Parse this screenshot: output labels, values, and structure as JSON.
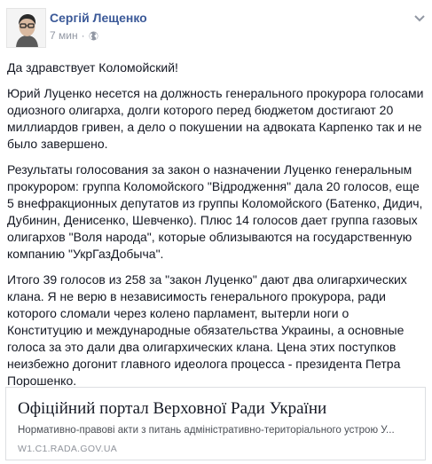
{
  "post": {
    "author": "Сергій Лещенко",
    "timestamp": "7 мин",
    "privacy_icon": "globe-icon",
    "menu_icon": "chevron-down-icon",
    "paragraphs": [
      "Да здравствует Коломойский!",
      "Юрий Луценко несется на должность генерального прокурора голосами одиозного олигарха, долги которого перед бюджетом достигают 20 миллиардов гривен, а дело о покушении на адвоката Карпенко так и не было завершено.",
      "Результаты голосования за закон о назначении Луценко генеральным прокурором: группа Коломойского \"Відродження\" дала 20 голосов, еще 5 внефракционных депутатов из группы Коломойского (Батенко, Дидич, Дубинин, Денисенко, Шевченко). Плюс 14 голосов дает группа газовых олигархов \"Воля народа\", которые облизываются на государственную компанию \"УкрГазДобыча\".",
      "Итого 39 голосов из 258 за \"закон Луценко\" дают два олигархических клана. Я не верю в независимость генерального прокурора, ради которого сломали через колено парламент, вытерли ноги о Конституцию и международные обязательства Украины, а основные голоса за это дали два олигархических клана. Цена этих поступков неизбежно догонит главного идеолога процесса - президента Петра Порошенко."
    ]
  },
  "link_card": {
    "title": "Офіційний портал Верховної Ради України",
    "description": "Нормативно-правові акти з питань адміністративно-територіального устрою У...",
    "domain": "W1.C1.RADA.GOV.UA"
  }
}
